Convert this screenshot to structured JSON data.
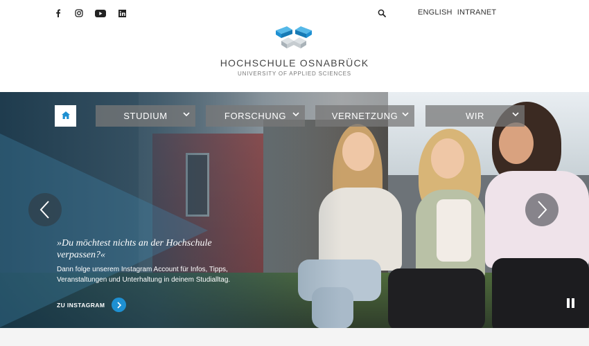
{
  "header": {
    "social": [
      {
        "name": "facebook-icon"
      },
      {
        "name": "instagram-icon"
      },
      {
        "name": "youtube-icon"
      },
      {
        "name": "linkedin-icon"
      }
    ],
    "search_icon": "search-icon",
    "links": {
      "english": "ENGLISH",
      "intranet": "INTRANET"
    }
  },
  "brand": {
    "title": "HOCHSCHULE OSNABRÜCK",
    "subtitle": "UNIVERSITY OF APPLIED SCIENCES",
    "colors": {
      "primary": "#1e90d2",
      "grey": "#9aa3a8"
    }
  },
  "nav": {
    "home_icon": "home-icon",
    "items": [
      {
        "label": "STUDIUM"
      },
      {
        "label": "FORSCHUNG"
      },
      {
        "label": "VERNETZUNG"
      },
      {
        "label": "WIR"
      }
    ]
  },
  "hero": {
    "headline": "»Du möchtest nichts an der Hochschule verpassen?«",
    "body": "Dann folge unserem Instagram Account für Infos, Tipps, Veranstaltungen und Unterhaltung in deinem Studialltag.",
    "cta_label": "ZU INSTAGRAM",
    "prev_icon": "chevron-left-icon",
    "next_icon": "chevron-right-icon",
    "pause_icon": "pause-icon"
  }
}
